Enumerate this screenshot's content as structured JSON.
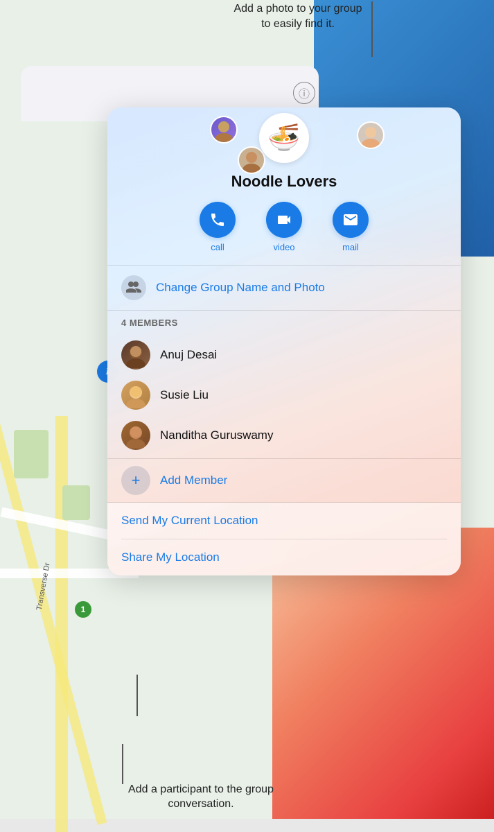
{
  "annotations": {
    "top": "Add a photo to your group to easily find it.",
    "bottom": "Add a participant to the group conversation."
  },
  "back_panel": {
    "info_icon": "ⓘ"
  },
  "sheet": {
    "group_name": "Noodle Lovers",
    "group_emoji": "🍜",
    "avatar_emojis": {
      "main": "🍜",
      "top_left": "👤",
      "top_right": "👤",
      "bottom_left": "👤"
    },
    "action_buttons": [
      {
        "id": "call",
        "icon": "📞",
        "label": "call"
      },
      {
        "id": "video",
        "icon": "📹",
        "label": "video"
      },
      {
        "id": "mail",
        "icon": "✉️",
        "label": "mail"
      }
    ],
    "change_group": {
      "icon": "👥",
      "label": "Change Group Name and Photo"
    },
    "members_header": "4 MEMBERS",
    "members": [
      {
        "name": "Anuj Desai",
        "emoji": "👨"
      },
      {
        "name": "Susie Liu",
        "emoji": "👩"
      },
      {
        "name": "Nanditha Guruswamy",
        "emoji": "👩"
      }
    ],
    "add_member": {
      "icon": "+",
      "label": "Add Member"
    },
    "location_actions": [
      {
        "id": "send-location",
        "label": "Send My Current Location"
      },
      {
        "id": "share-location",
        "label": "Share My Location"
      }
    ]
  },
  "map": {
    "circle_label": "I'",
    "green_badge": "1"
  }
}
